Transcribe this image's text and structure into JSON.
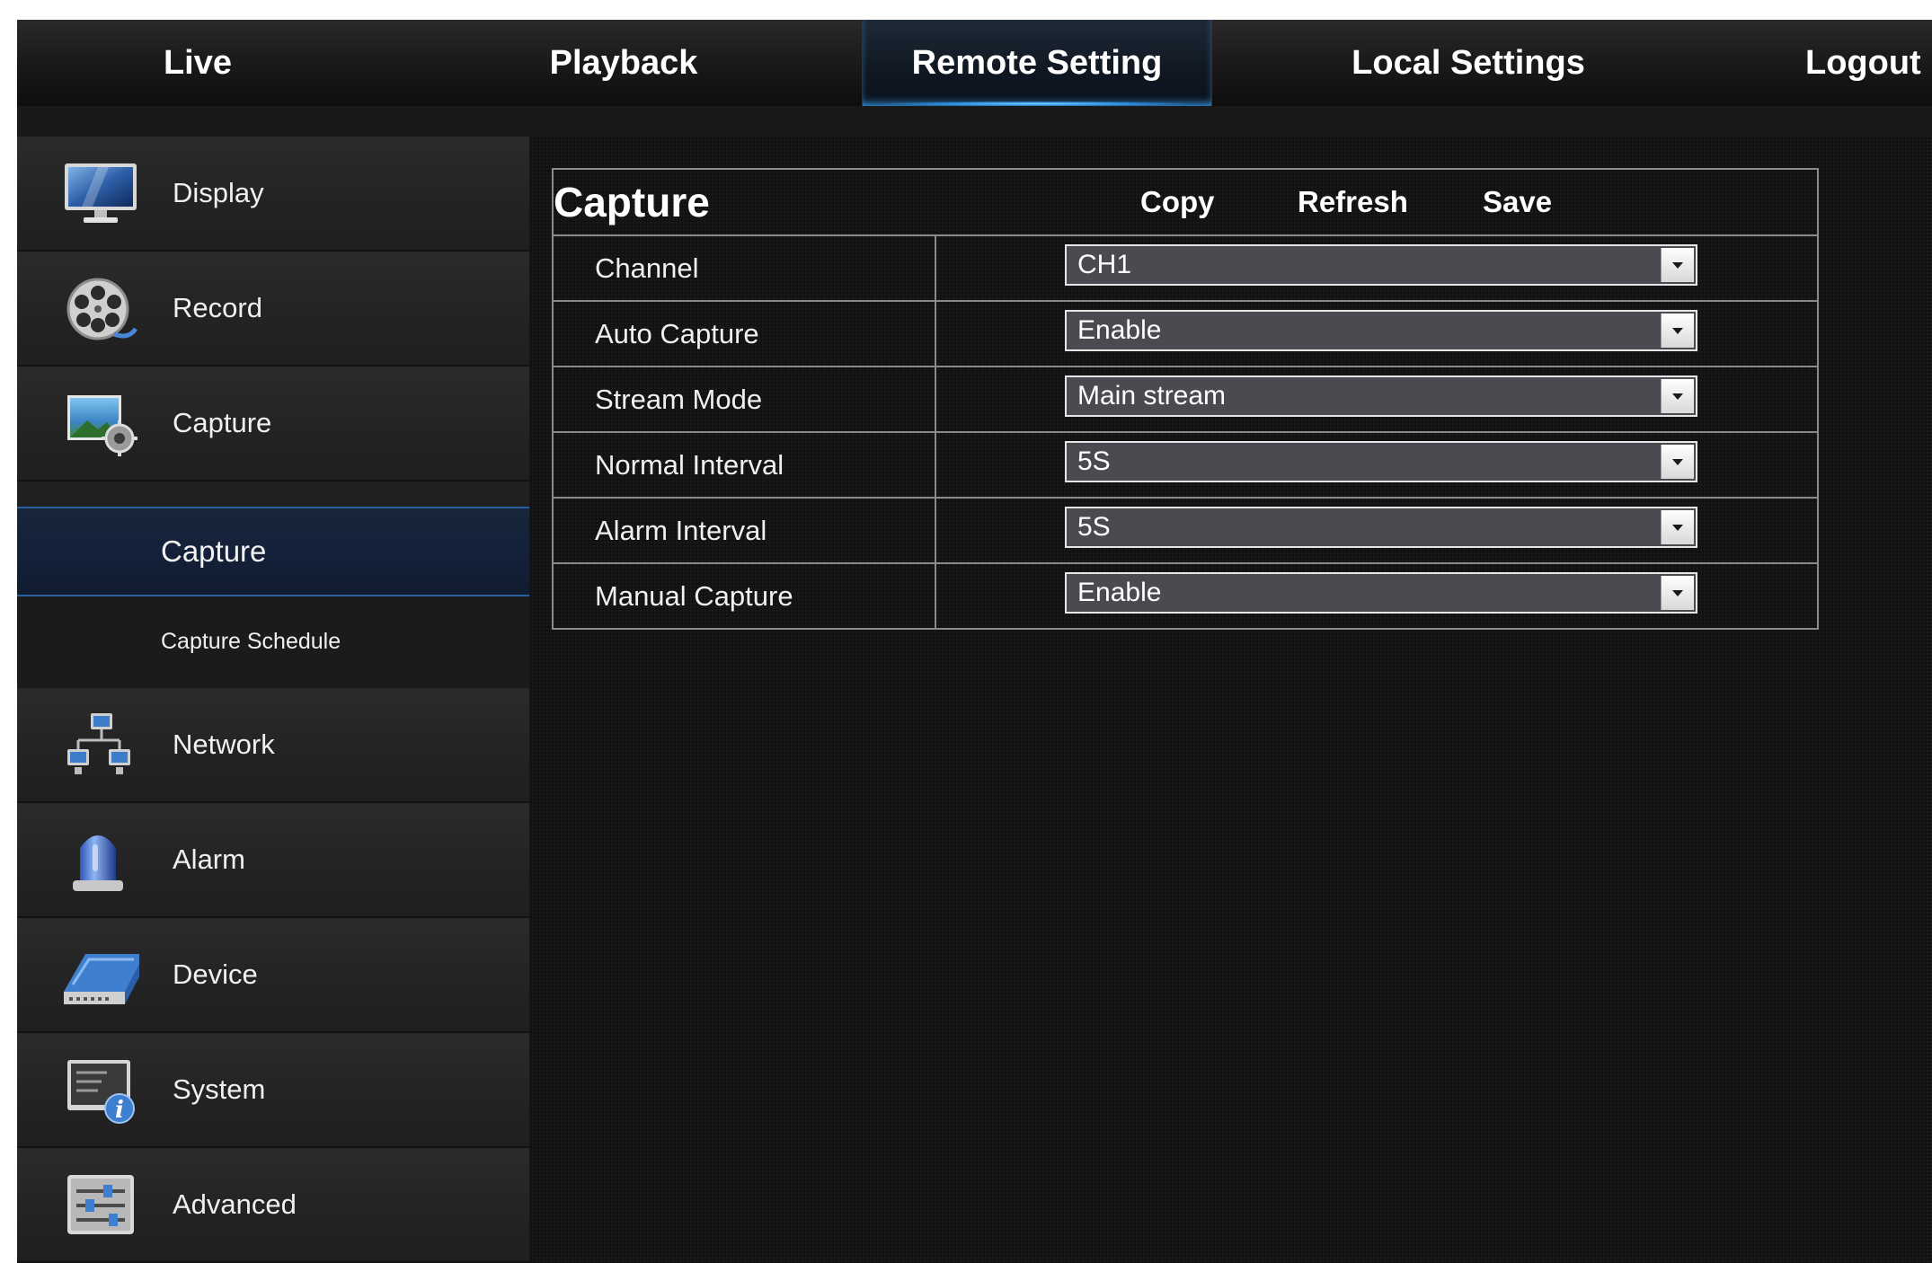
{
  "nav": {
    "tabs": [
      {
        "label": "Live"
      },
      {
        "label": "Playback"
      },
      {
        "label": "Remote Setting",
        "active": true
      },
      {
        "label": "Local Settings"
      },
      {
        "label": "Logout"
      }
    ]
  },
  "sidebar": {
    "items": [
      {
        "label": "Display",
        "icon": "monitor-icon"
      },
      {
        "label": "Record",
        "icon": "film-reel-icon"
      },
      {
        "label": "Capture",
        "icon": "camera-capture-icon"
      },
      {
        "label": "Network",
        "icon": "network-icon"
      },
      {
        "label": "Alarm",
        "icon": "alarm-light-icon"
      },
      {
        "label": "Device",
        "icon": "hard-drive-icon"
      },
      {
        "label": "System",
        "icon": "system-info-icon"
      },
      {
        "label": "Advanced",
        "icon": "sliders-icon"
      }
    ],
    "sub_items": [
      {
        "label": "Capture",
        "active": true
      },
      {
        "label": "Capture Schedule"
      }
    ]
  },
  "panel": {
    "title": "Capture",
    "buttons": {
      "copy": "Copy",
      "refresh": "Refresh",
      "save": "Save"
    },
    "rows": [
      {
        "label": "Channel",
        "value": "CH1"
      },
      {
        "label": "Auto Capture",
        "value": "Enable"
      },
      {
        "label": "Stream Mode",
        "value": "Main stream"
      },
      {
        "label": "Normal Interval",
        "value": "5S"
      },
      {
        "label": "Alarm Interval",
        "value": "5S"
      },
      {
        "label": "Manual Capture",
        "value": "Enable"
      }
    ]
  },
  "colors": {
    "active_tab_glow": "#3aa8ff",
    "active_subitem_bg": "#14213a",
    "select_bg": "#4a4a50",
    "border": "#8a8a8a"
  }
}
